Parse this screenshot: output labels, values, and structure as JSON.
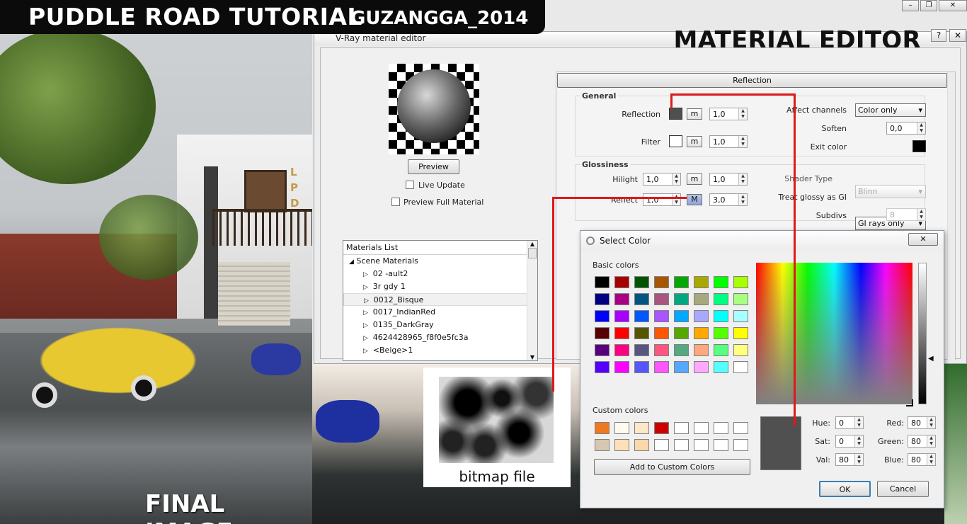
{
  "banner": {
    "title": "PUDDLE ROAD TUTORIAL",
    "author": "GUZANGGA_2014"
  },
  "photo": {
    "caption": "FINAL IMAGE",
    "sign_letters": "L P D"
  },
  "bg_window": {
    "buttons": [
      "minimize-button",
      "restore-button",
      "close-button"
    ]
  },
  "vray": {
    "window_title": "V-Ray material editor",
    "overlay_title": "MATERIAL EDITOR",
    "help_label": "?",
    "close_label": "✕",
    "preview_button": "Preview",
    "live_update": "Live Update",
    "preview_full": "Preview Full Material",
    "materials": {
      "header": "Materials List",
      "root": "Scene Materials",
      "items": [
        "02 -ault2",
        "3r gdy 1",
        "0012_Bisque",
        "0017_IndianRed",
        "0135_DarkGray",
        "4624428965_f8f0e5fc3a",
        "<Beige>1"
      ],
      "selected_index": 2
    },
    "reflection": {
      "section": "Reflection",
      "general": "General",
      "reflection_label": "Reflection",
      "reflection_value": "1,0",
      "filter_label": "Filter",
      "filter_value": "1,0",
      "m_label": "m",
      "affect_channels_label": "Affect channels",
      "affect_channels_value": "Color only",
      "soften_label": "Soften",
      "soften_value": "0,0",
      "exit_color_label": "Exit color",
      "glossiness": "Glossiness",
      "hilight_label": "Hilight",
      "hilight_value": "1,0",
      "hilight_value2": "1,0",
      "reflect_label": "Reflect",
      "reflect_value": "1,0",
      "reflect_value2": "3,0",
      "M_label": "M",
      "shader_type_label": "Shader Type",
      "shader_type_value": "Blinn",
      "treat_glossy_label": "Treat glossy as GI",
      "treat_glossy_value": "GI rays only",
      "subdivs_label": "Subdivs",
      "subdivs_value": "8"
    }
  },
  "select_color": {
    "title": "Select Color",
    "close_label": "✕",
    "basic_label": "Basic colors",
    "basic_colors": [
      "#000000",
      "#a80000",
      "#005600",
      "#a85600",
      "#00a800",
      "#a8a800",
      "#00ff00",
      "#a8ff00",
      "#000080",
      "#a80080",
      "#005680",
      "#a85680",
      "#00a880",
      "#a8a880",
      "#00ff80",
      "#a8ff80",
      "#0000ff",
      "#a800ff",
      "#0056ff",
      "#a856ff",
      "#00a8ff",
      "#a8a8ff",
      "#00ffff",
      "#a8ffff",
      "#560000",
      "#ff0000",
      "#565600",
      "#ff5600",
      "#56a800",
      "#ffa800",
      "#56ff00",
      "#ffff00",
      "#560080",
      "#ff0080",
      "#565680",
      "#ff5680",
      "#56a880",
      "#ffa880",
      "#56ff80",
      "#ffff80",
      "#5600ff",
      "#ff00ff",
      "#5656ff",
      "#ff56ff",
      "#56a8ff",
      "#ffa8ff",
      "#56ffff",
      "#ffffff"
    ],
    "custom_label": "Custom colors",
    "custom_colors": [
      "#f07820",
      "#fffbee",
      "#fde8c8",
      "#cc0000",
      "#ffffff",
      "#ffffff",
      "#ffffff",
      "#ffffff",
      "#d7c7b0",
      "#fde0b8",
      "#fbd8a8",
      "#ffffff",
      "#ffffff",
      "#ffffff",
      "#ffffff",
      "#ffffff"
    ],
    "add_custom": "Add to Custom Colors",
    "preview_color": "#505050",
    "hue_label": "Hue:",
    "hue": "0",
    "sat_label": "Sat:",
    "sat": "0",
    "val_label": "Val:",
    "val": "80",
    "red_label": "Red:",
    "red": "80",
    "green_label": "Green:",
    "green": "80",
    "blue_label": "Blue:",
    "blue": "80",
    "ok": "OK",
    "cancel": "Cancel"
  },
  "bitmap": {
    "caption": "bitmap file"
  },
  "accent": "#e0181a"
}
